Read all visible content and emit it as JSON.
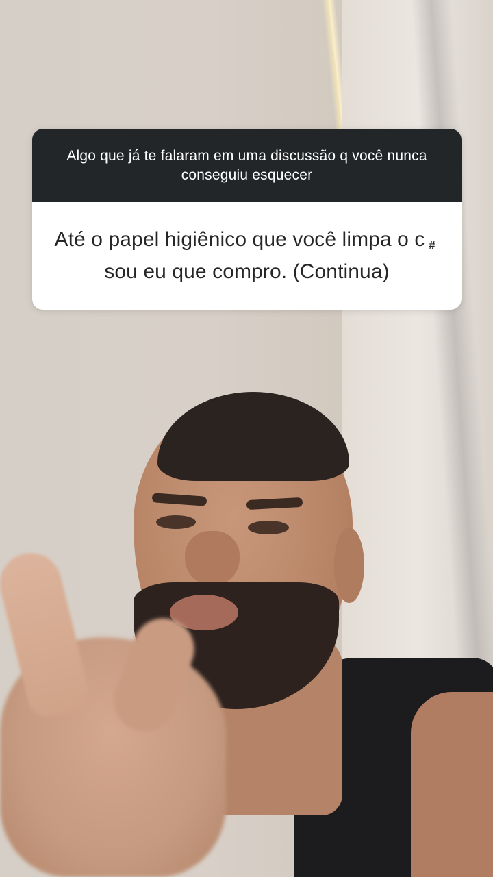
{
  "story": {
    "question_sticker": {
      "question": "Algo que já te falaram em uma discussão q você nunca conseguiu esquecer",
      "answer_part1": "Até o papel higiênico que você limpa o c",
      "censor_glyph": "#",
      "answer_part2": "sou eu que compro. (Continua)",
      "header_color": "#222629",
      "body_color": "#ffffff"
    }
  }
}
